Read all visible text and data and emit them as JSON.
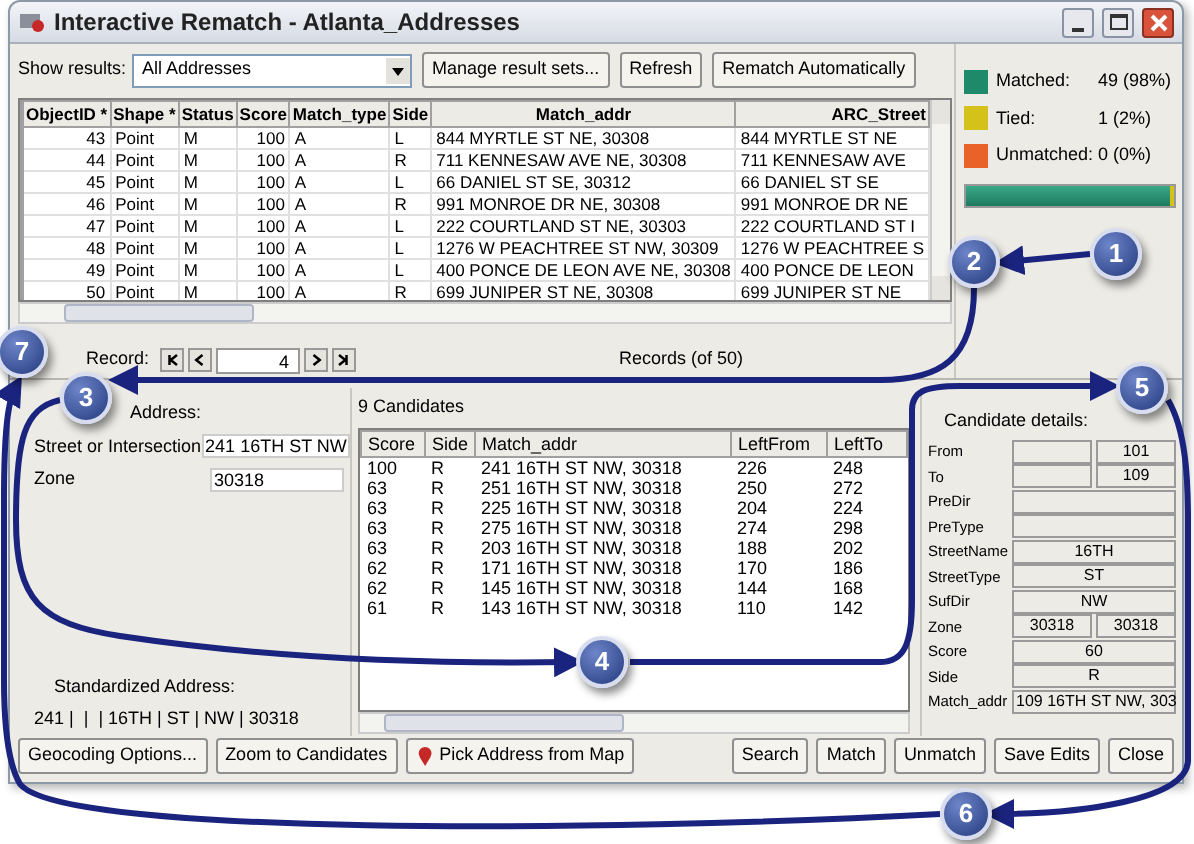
{
  "window": {
    "title": "Interactive Rematch - Atlanta_Addresses"
  },
  "toolbar": {
    "label": "Show results:",
    "dropdown": "All Addresses",
    "buttons": [
      "Manage result sets...",
      "Refresh",
      "Rematch Automatically"
    ]
  },
  "results_table": {
    "columns": [
      "ObjectID *",
      "Shape *",
      "Status",
      "Score",
      "Match_type",
      "Side",
      "Match_addr",
      "ARC_Street"
    ],
    "rows": [
      [
        "43",
        "Point",
        "M",
        "100",
        "A",
        "L",
        "844 MYRTLE ST NE, 30308",
        "844 MYRTLE ST NE"
      ],
      [
        "44",
        "Point",
        "M",
        "100",
        "A",
        "R",
        "711 KENNESAW AVE NE, 30308",
        "711 KENNESAW AVE"
      ],
      [
        "45",
        "Point",
        "M",
        "100",
        "A",
        "L",
        "66 DANIEL ST SE, 30312",
        "66 DANIEL ST SE"
      ],
      [
        "46",
        "Point",
        "M",
        "100",
        "A",
        "R",
        "991 MONROE DR NE, 30308",
        "991 MONROE DR NE"
      ],
      [
        "47",
        "Point",
        "M",
        "100",
        "A",
        "L",
        "222 COURTLAND ST NE, 30303",
        "222 COURTLAND ST I"
      ],
      [
        "48",
        "Point",
        "M",
        "100",
        "A",
        "L",
        "1276 W PEACHTREE ST NW, 30309",
        "1276 W PEACHTREE S"
      ],
      [
        "49",
        "Point",
        "M",
        "100",
        "A",
        "L",
        "400 PONCE DE LEON AVE NE, 30308",
        "400 PONCE DE LEON"
      ],
      [
        "50",
        "Point",
        "M",
        "100",
        "A",
        "R",
        "699 JUNIPER ST NE, 30308",
        "699 JUNIPER ST NE"
      ]
    ]
  },
  "record_nav": {
    "label": "Record:",
    "value": "4",
    "summary": "Records (of 50)"
  },
  "stats": {
    "items": [
      {
        "label": "Matched:",
        "value": "49 (98%)",
        "color": "#1e8a6a"
      },
      {
        "label": "Tied:",
        "value": "1 (2%)",
        "color": "#d4c21a"
      },
      {
        "label": "Unmatched:",
        "value": "0 (0%)",
        "color": "#e8622a"
      }
    ],
    "bar": {
      "level": 0.98
    }
  },
  "address": {
    "heading": "Address:",
    "fields": [
      {
        "label": "Street or Intersection",
        "value": "241 16TH ST NW"
      },
      {
        "label": "Zone",
        "value": "30318"
      }
    ],
    "standardized_heading": "Standardized Address:",
    "standardized": "241 |  |  | 16TH | ST | NW | 30318"
  },
  "candidates": {
    "title": "9 Candidates",
    "columns": [
      "Score",
      "Side",
      "Match_addr",
      "LeftFrom",
      "LeftTo"
    ],
    "rows": [
      [
        "100",
        "R",
        "241 16TH ST NW, 30318",
        "226",
        "248"
      ],
      [
        "63",
        "R",
        "251 16TH ST NW, 30318",
        "250",
        "272"
      ],
      [
        "63",
        "R",
        "225 16TH ST NW, 30318",
        "204",
        "224"
      ],
      [
        "63",
        "R",
        "275 16TH ST NW, 30318",
        "274",
        "298"
      ],
      [
        "63",
        "R",
        "203 16TH ST NW, 30318",
        "188",
        "202"
      ],
      [
        "62",
        "R",
        "171 16TH ST NW, 30318",
        "170",
        "186"
      ],
      [
        "62",
        "R",
        "145 16TH ST NW, 30318",
        "144",
        "168"
      ],
      [
        "61",
        "R",
        "143 16TH ST NW, 30318",
        "110",
        "142"
      ]
    ]
  },
  "details": {
    "heading": "Candidate details:",
    "fields": [
      {
        "label": "From",
        "kind": "pair",
        "values": [
          "101"
        ]
      },
      {
        "label": "To",
        "kind": "pair",
        "values": [
          "109"
        ]
      },
      {
        "label": "PreDir",
        "kind": "single"
      },
      {
        "label": "PreType",
        "kind": "single"
      },
      {
        "label": "StreetName",
        "kind": "single",
        "values": [
          "16TH"
        ]
      },
      {
        "label": "StreetType",
        "kind": "single",
        "values": [
          "ST"
        ]
      },
      {
        "label": "SufDir",
        "kind": "single",
        "values": [
          "NW"
        ]
      },
      {
        "label": "Zone",
        "kind": "pair",
        "values": [
          "30318",
          "30318"
        ]
      },
      {
        "label": "Score",
        "kind": "single",
        "values": [
          "60"
        ]
      },
      {
        "label": "Side",
        "kind": "single",
        "values": [
          "R"
        ]
      },
      {
        "label": "Match_addr",
        "kind": "single",
        "values": [
          "109 16TH ST NW, 303"
        ]
      }
    ]
  },
  "buttons": [
    {
      "label": "Geocoding Options...",
      "kind": "plain"
    },
    {
      "label": "Zoom to Candidates",
      "kind": "plain"
    },
    {
      "label": "Pick Address from Map",
      "kind": "icon"
    },
    {
      "label": "Search",
      "kind": "plain"
    },
    {
      "label": "Match",
      "kind": "plain"
    },
    {
      "label": "Unmatch",
      "kind": "plain"
    },
    {
      "label": "Save Edits",
      "kind": "plain"
    },
    {
      "label": "Close",
      "kind": "plain"
    }
  ],
  "callouts": [
    "1",
    "2",
    "3",
    "4",
    "5",
    "6",
    "7"
  ]
}
